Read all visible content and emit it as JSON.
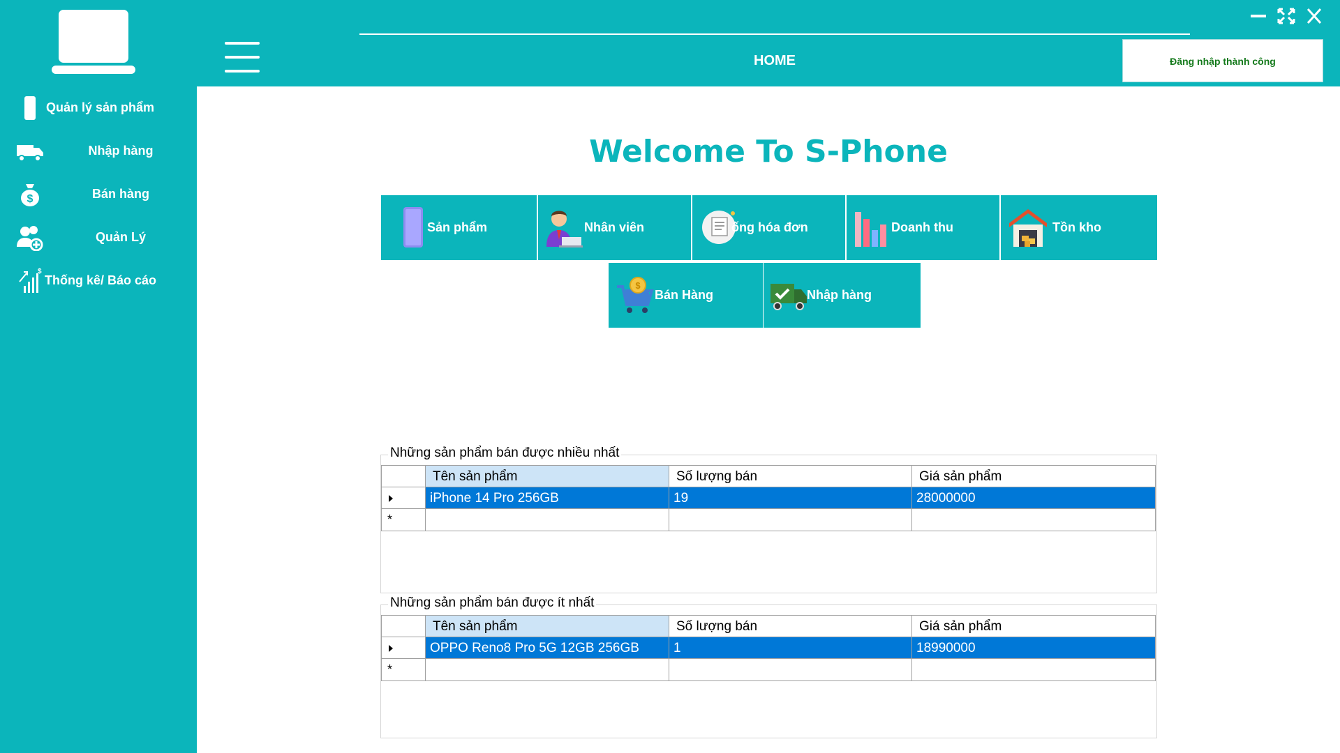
{
  "header": {
    "title": "HOME",
    "status": "Đăng nhập thành công"
  },
  "sidebar": {
    "items": [
      {
        "label": "Quản lý sản phẩm",
        "icon": "phone-icon"
      },
      {
        "label": "Nhập hàng",
        "icon": "truck-icon"
      },
      {
        "label": "Bán hàng",
        "icon": "money-bag-icon"
      },
      {
        "label": "Quản Lý",
        "icon": "users-add-icon"
      },
      {
        "label": "Thống kê/ Báo cáo",
        "icon": "stats-icon"
      }
    ]
  },
  "main": {
    "welcome": "Welcome To S-Phone",
    "tiles_row1": [
      {
        "label": "Sản phẩm",
        "icon": "smartphone-icon"
      },
      {
        "label": "Nhân viên",
        "icon": "employee-icon"
      },
      {
        "label": "ống hóa đơn",
        "icon": "invoice-icon"
      },
      {
        "label": "Doanh thu",
        "icon": "bar-chart-icon"
      },
      {
        "label": "Tồn kho",
        "icon": "warehouse-icon"
      }
    ],
    "tiles_row2": [
      {
        "label": "Bán Hàng",
        "icon": "shopping-cart-icon"
      },
      {
        "label": "Nhập hàng",
        "icon": "delivery-truck-icon"
      }
    ]
  },
  "best_sellers": {
    "title": "Những sản phẩm bán được nhiều nhất",
    "columns": [
      "Tên sản phẩm",
      "Số lượng bán",
      "Giá sản phẩm"
    ],
    "rows": [
      [
        "iPhone 14 Pro 256GB",
        "19",
        "28000000"
      ]
    ],
    "new_row_marker": "*"
  },
  "worst_sellers": {
    "title": "Những sản phẩm bán được ít nhất",
    "columns": [
      "Tên sản phẩm",
      "Số lượng bán",
      "Giá sản phẩm"
    ],
    "rows": [
      [
        "OPPO Reno8 Pro 5G 12GB 256GB",
        "1",
        "18990000"
      ]
    ],
    "new_row_marker": "*"
  },
  "colors": {
    "accent": "#0bb5bb",
    "selection": "#0078d7",
    "header_cell": "#cde4f7",
    "status_text": "#157a1c"
  }
}
